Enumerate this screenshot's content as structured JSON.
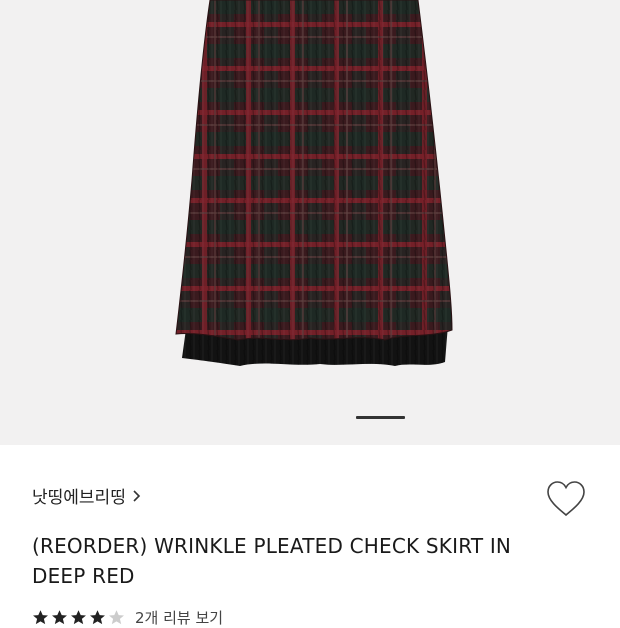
{
  "gallery": {
    "image_alt": "plaid pleated skirt product photo",
    "current_page": 1,
    "indicator_icon": "page-indicator"
  },
  "product": {
    "brand": "낫띵에브리띵",
    "brand_chevron_icon": "chevron-right-icon",
    "title": "(REORDER) WRINKLE PLEATED CHECK SKIRT IN DEEP RED",
    "wishlist_icon": "heart-outline-icon",
    "rating": 4,
    "rating_max": 5,
    "reviews_label": "2개 리뷰 보기"
  },
  "colors": {
    "plaid_base": "#3d1a1e",
    "plaid_red": "#6e1f26",
    "plaid_green": "#1d2b24",
    "star_filled": "#222222",
    "star_empty": "#cccccc",
    "gallery_bg": "#f2f1f1"
  }
}
